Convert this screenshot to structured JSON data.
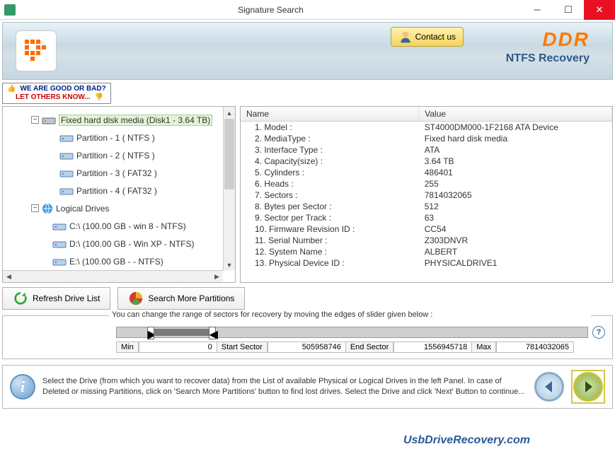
{
  "window": {
    "title": "Signature Search"
  },
  "banner": {
    "contact_label": "Contact us",
    "brand": "DDR",
    "subtitle": "NTFS Recovery"
  },
  "review": {
    "line1": "WE ARE GOOD OR BAD?",
    "line2": "LET OTHERS KNOW..."
  },
  "tree": {
    "root_label": "Fixed hard disk media (Disk1 - 3.64 TB)",
    "partitions": [
      "Partition - 1 ( NTFS )",
      "Partition - 2 ( NTFS )",
      "Partition - 3 ( FAT32 )",
      "Partition - 4 ( FAT32 )"
    ],
    "logical_label": "Logical Drives",
    "logical": [
      "C:\\ (100.00 GB - win 8 - NTFS)",
      "D:\\ (100.00 GB - Win XP - NTFS)",
      "E:\\ (100.00 GB -  - NTFS)"
    ]
  },
  "props_header": {
    "name": "Name",
    "value": "Value"
  },
  "props": [
    {
      "name": "1. Model :",
      "value": "ST4000DM000-1F2168 ATA Device"
    },
    {
      "name": "2. MediaType :",
      "value": "Fixed hard disk media"
    },
    {
      "name": "3. Interface Type :",
      "value": "ATA"
    },
    {
      "name": "4. Capacity(size) :",
      "value": "3.64 TB"
    },
    {
      "name": "5. Cylinders :",
      "value": "486401"
    },
    {
      "name": "6. Heads :",
      "value": "255"
    },
    {
      "name": "7. Sectors :",
      "value": "7814032065"
    },
    {
      "name": "8. Bytes per Sector :",
      "value": "512"
    },
    {
      "name": "9. Sector per Track :",
      "value": "63"
    },
    {
      "name": "10. Firmware Revision ID :",
      "value": "CC54"
    },
    {
      "name": "11. Serial Number :",
      "value": "Z303DNVR"
    },
    {
      "name": "12. System Name :",
      "value": "ALBERT"
    },
    {
      "name": "13. Physical Device ID :",
      "value": "PHYSICALDRIVE1"
    }
  ],
  "actions": {
    "refresh": "Refresh Drive List",
    "search_more": "Search More Partitions"
  },
  "range": {
    "hint": "You can change the range of sectors for recovery by moving the edges of slider given below :",
    "min_label": "Min",
    "min": "0",
    "start_label": "Start Sector",
    "start": "505958746",
    "end_label": "End Sector",
    "end": "1556945718",
    "max_label": "Max",
    "max": "7814032065"
  },
  "footer": {
    "instruction": "Select the Drive (from which you want to recover data) from the List of available Physical or Logical Drives in the left Panel. In case of Deleted or missing Partitions, click on 'Search More Partitions' button to find lost drives. Select the Drive and click 'Next' Button to continue..."
  },
  "watermark": "UsbDriveRecovery.com"
}
